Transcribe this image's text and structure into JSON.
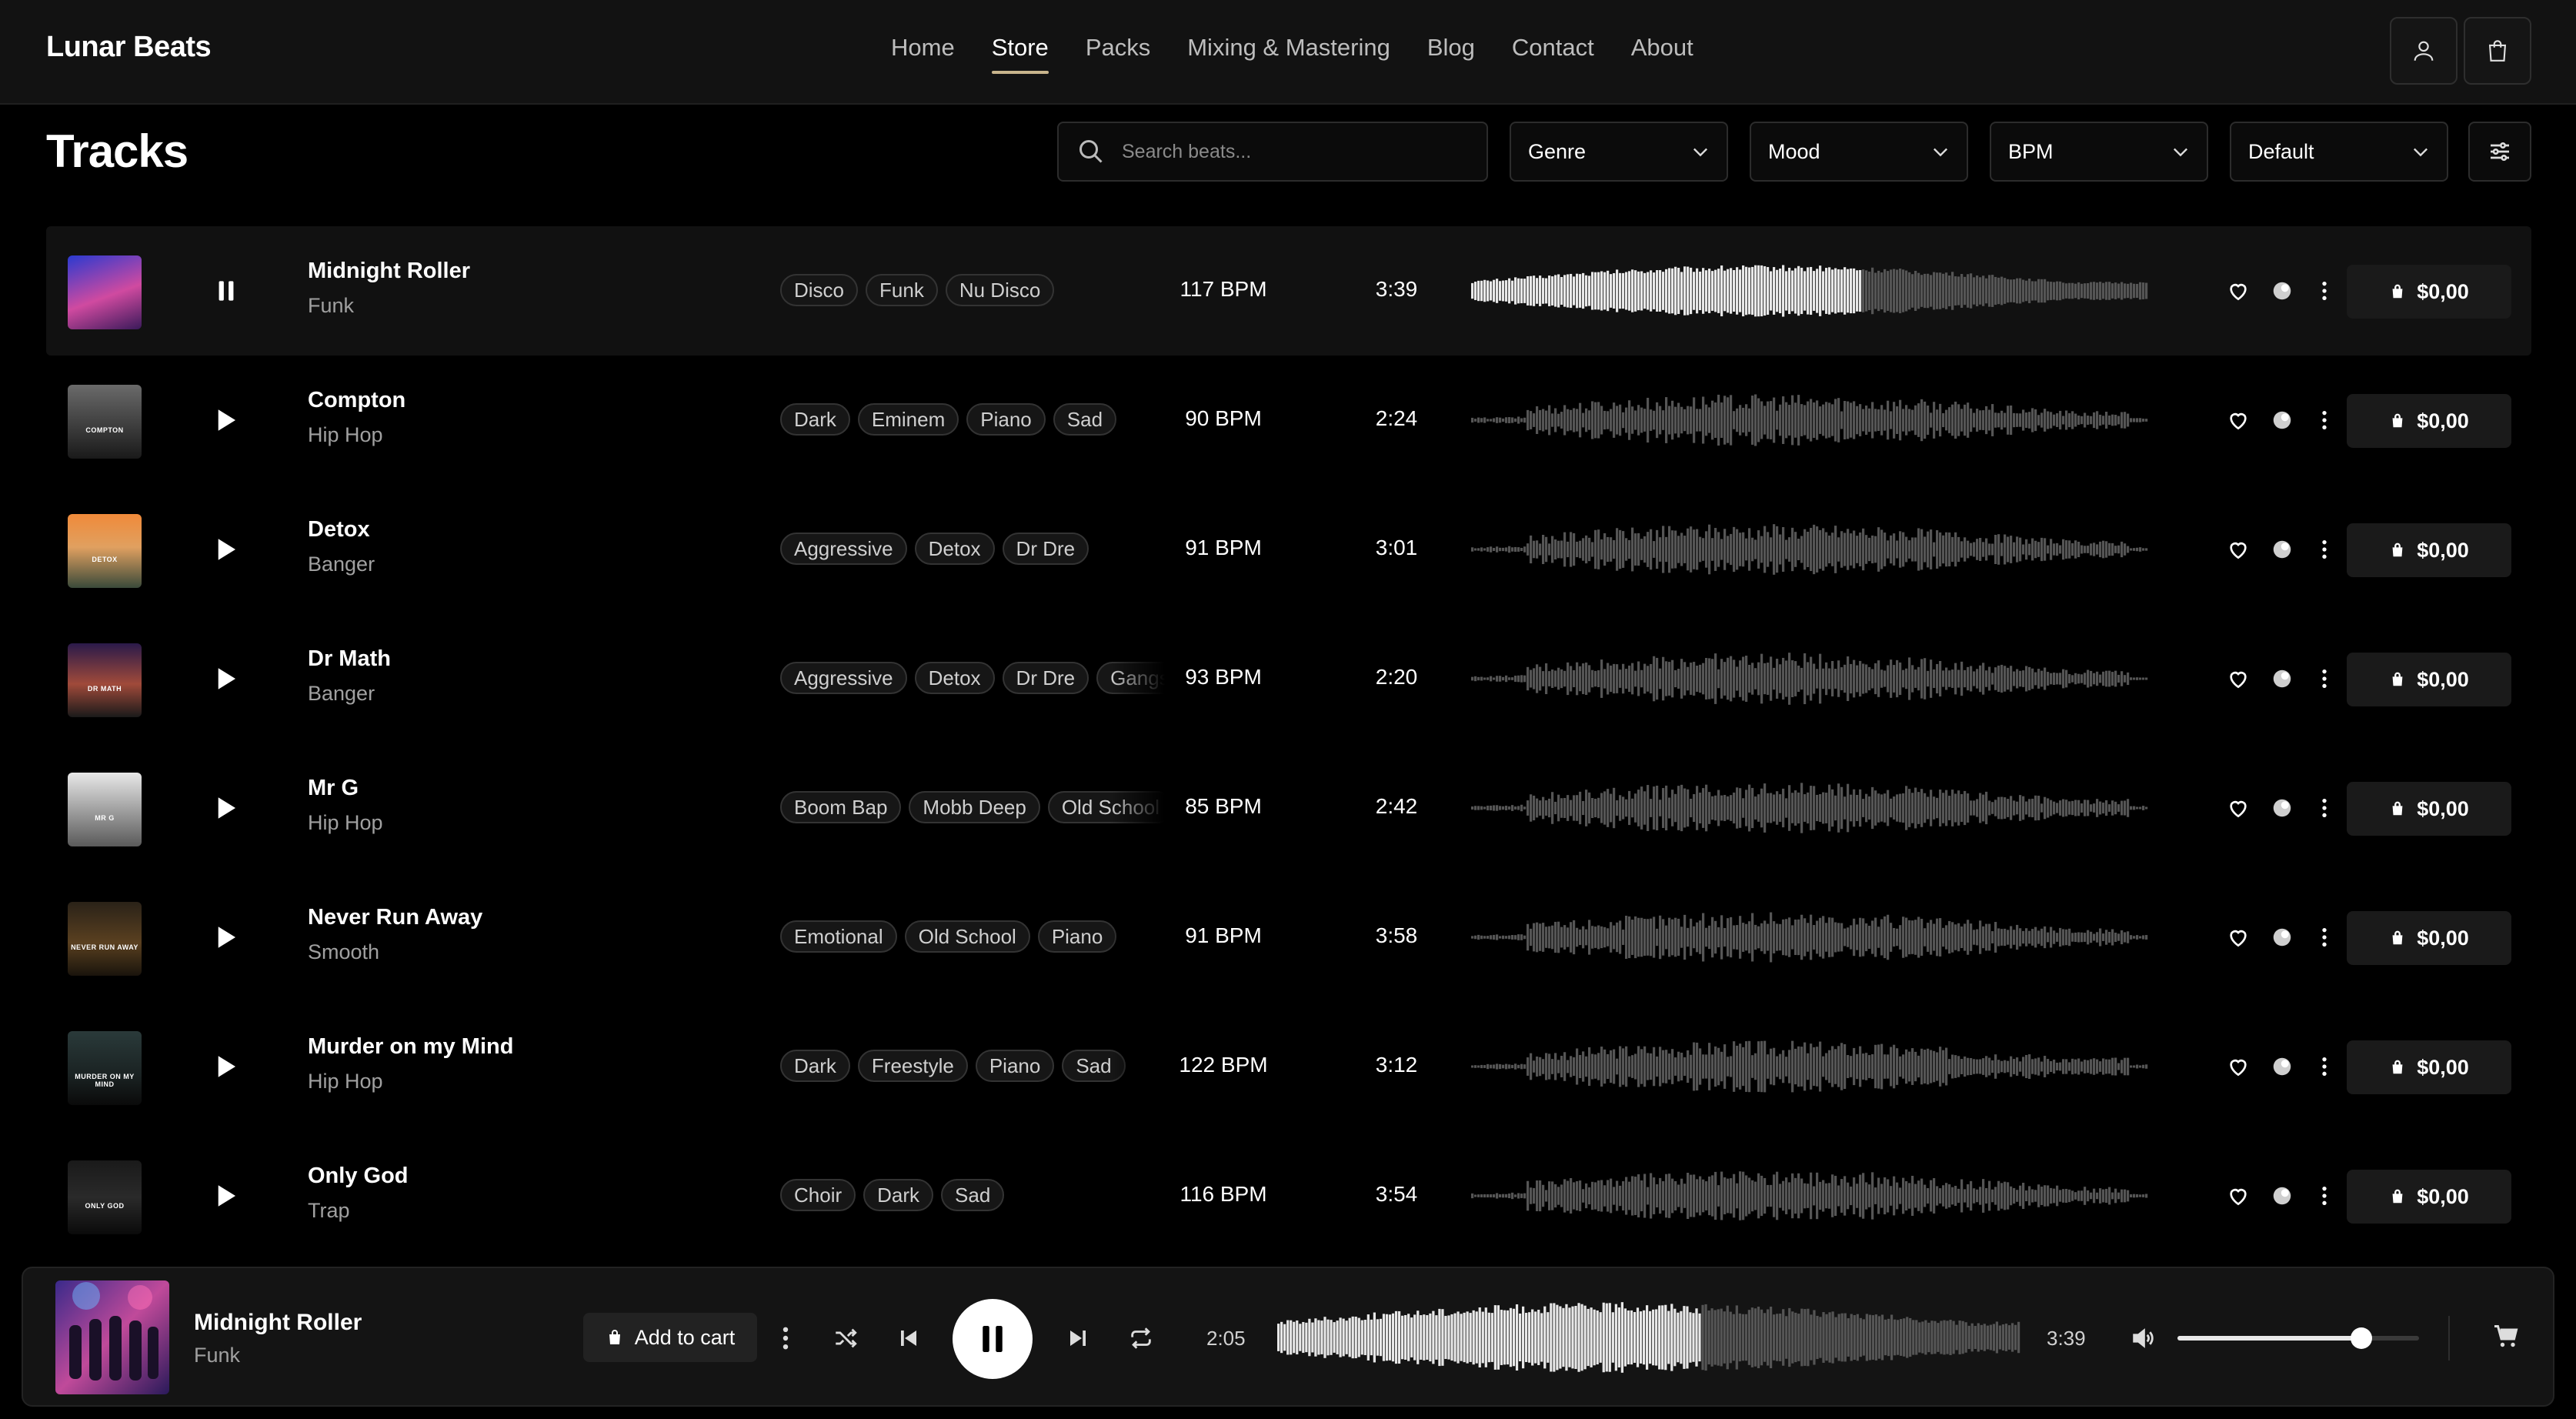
{
  "brand": {
    "name": "Lunar Beats"
  },
  "nav": {
    "items": [
      {
        "label": "Home"
      },
      {
        "label": "Store"
      },
      {
        "label": "Packs"
      },
      {
        "label": "Mixing & Mastering"
      },
      {
        "label": "Blog"
      },
      {
        "label": "Contact"
      },
      {
        "label": "About"
      }
    ],
    "active": "Store"
  },
  "header_icons": {
    "account": "user-icon",
    "cart": "shopping-bag-icon"
  },
  "page": {
    "title": "Tracks"
  },
  "toolbar": {
    "search_placeholder": "Search beats...",
    "genre": "Genre",
    "mood": "Mood",
    "bpm": "BPM",
    "sort": "Default",
    "filter_icon": "sliders-icon"
  },
  "tracks": [
    {
      "title": "Midnight Roller",
      "genre": "Funk",
      "tags": [
        "Disco",
        "Funk",
        "Nu Disco"
      ],
      "bpm": "117 BPM",
      "duration": "3:39",
      "price": "$0,00",
      "playing": true,
      "progress": 0.575
    },
    {
      "title": "Compton",
      "genre": "Hip Hop",
      "tags": [
        "Dark",
        "Eminem",
        "Piano",
        "Sad"
      ],
      "bpm": "90 BPM",
      "duration": "2:24",
      "price": "$0,00",
      "playing": false,
      "progress": 0,
      "cover_text": "COMPTON"
    },
    {
      "title": "Detox",
      "genre": "Banger",
      "tags": [
        "Aggressive",
        "Detox",
        "Dr Dre"
      ],
      "bpm": "91 BPM",
      "duration": "3:01",
      "price": "$0,00",
      "playing": false,
      "progress": 0,
      "cover_text": "DETOX"
    },
    {
      "title": "Dr Math",
      "genre": "Banger",
      "tags": [
        "Aggressive",
        "Detox",
        "Dr Dre",
        "Gangsta"
      ],
      "bpm": "93 BPM",
      "duration": "2:20",
      "price": "$0,00",
      "playing": false,
      "progress": 0,
      "cover_text": "DR MATH"
    },
    {
      "title": "Mr G",
      "genre": "Hip Hop",
      "tags": [
        "Boom Bap",
        "Mobb Deep",
        "Old School"
      ],
      "bpm": "85 BPM",
      "duration": "2:42",
      "price": "$0,00",
      "playing": false,
      "progress": 0,
      "cover_text": "MR G"
    },
    {
      "title": "Never Run Away",
      "genre": "Smooth",
      "tags": [
        "Emotional",
        "Old School",
        "Piano"
      ],
      "bpm": "91 BPM",
      "duration": "3:58",
      "price": "$0,00",
      "playing": false,
      "progress": 0,
      "cover_text": "NEVER RUN AWAY"
    },
    {
      "title": "Murder on my Mind",
      "genre": "Hip Hop",
      "tags": [
        "Dark",
        "Freestyle",
        "Piano",
        "Sad"
      ],
      "bpm": "122 BPM",
      "duration": "3:12",
      "price": "$0,00",
      "playing": false,
      "progress": 0,
      "cover_text": "MURDER ON MY MIND"
    },
    {
      "title": "Only God",
      "genre": "Trap",
      "tags": [
        "Choir",
        "Dark",
        "Sad"
      ],
      "bpm": "116 BPM",
      "duration": "3:54",
      "price": "$0,00",
      "playing": false,
      "progress": 0,
      "cover_text": "ONLY GOD"
    }
  ],
  "row_icons": {
    "like": "heart-icon",
    "share": "share-icon",
    "more": "more-vertical-icon",
    "buy": "shopping-bag-icon"
  },
  "player": {
    "title": "Midnight Roller",
    "genre": "Funk",
    "add_to_cart": "Add to cart",
    "current_time": "2:05",
    "total_time": "3:39",
    "progress": 0.57,
    "volume": 0.76,
    "icons": [
      "more-vertical-icon",
      "shuffle-icon",
      "skip-back-icon",
      "pause-icon",
      "skip-forward-icon",
      "repeat-icon",
      "volume-icon",
      "cart-icon"
    ]
  },
  "colors": {
    "background": "#000000",
    "header": "#121212",
    "accent": "#c8b48c",
    "wave_played": "#e8e8e8",
    "wave_unplayed": "#555555"
  }
}
